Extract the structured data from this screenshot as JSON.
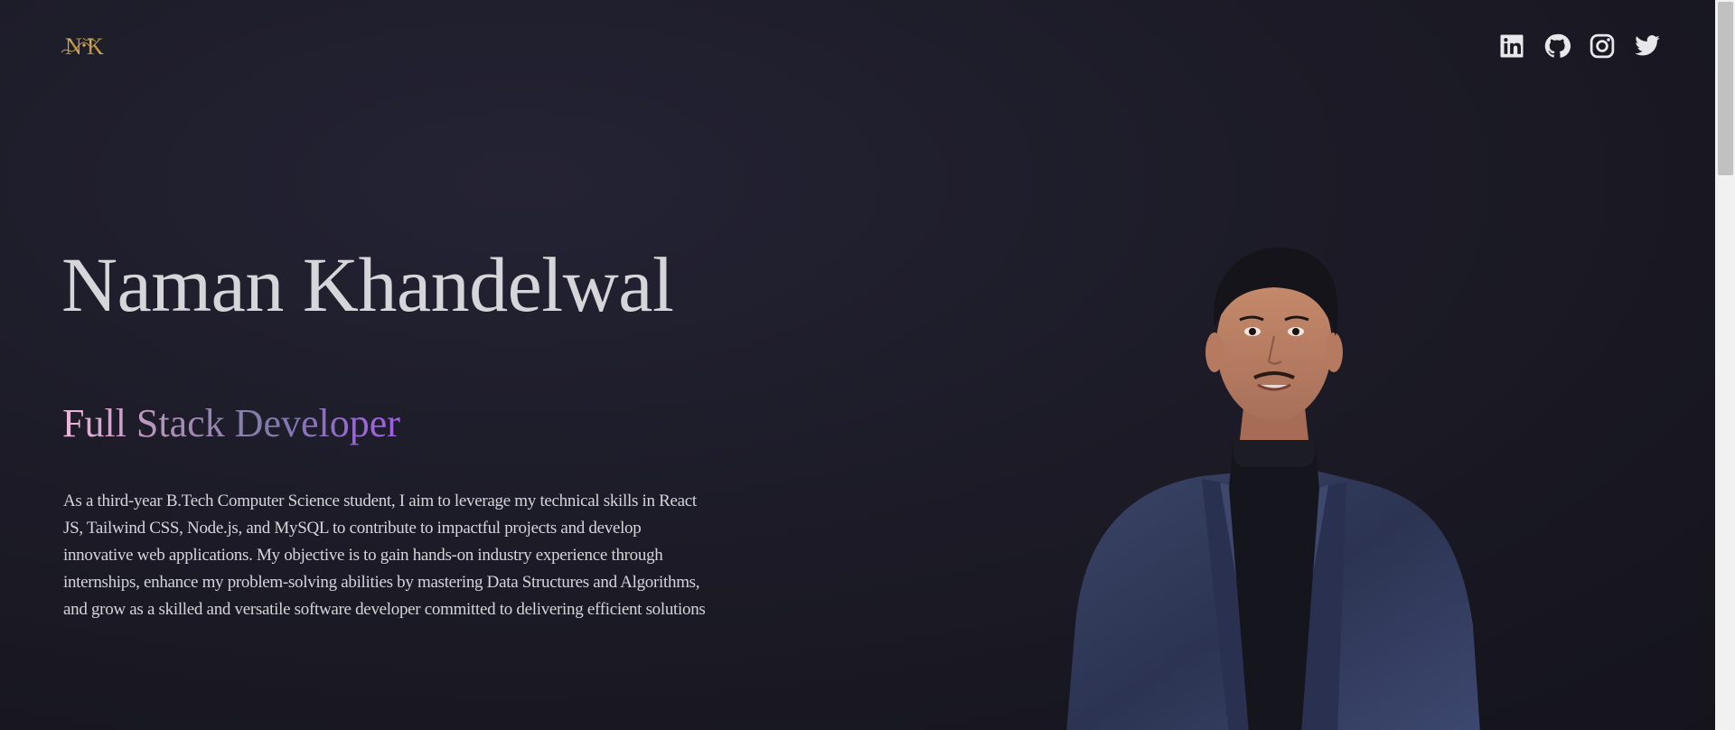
{
  "header": {
    "logo_text": "NK",
    "socials": [
      {
        "name": "LinkedIn",
        "icon": "linkedin-icon"
      },
      {
        "name": "GitHub",
        "icon": "github-icon"
      },
      {
        "name": "Instagram",
        "icon": "instagram-icon"
      },
      {
        "name": "Twitter",
        "icon": "twitter-icon"
      }
    ]
  },
  "hero": {
    "name": "Naman Khandelwal",
    "role": "Full Stack Developer",
    "bio": "As a third-year B.Tech Computer Science student, I aim to leverage my technical skills in React JS, Tailwind CSS, Node.js, and MySQL to contribute to impactful projects and develop innovative web applications. My objective is to gain hands-on industry experience through internships, enhance my problem-solving abilities by mastering Data Structures and Algorithms, and grow as a skilled and versatile software developer committed to delivering efficient solutions"
  },
  "colors": {
    "background": "#1c1b27",
    "text": "#d6d6da",
    "role_gradient_start": "#f0b6de",
    "role_gradient_end": "#a35ee8",
    "logo_gold": "#c8a24a"
  }
}
